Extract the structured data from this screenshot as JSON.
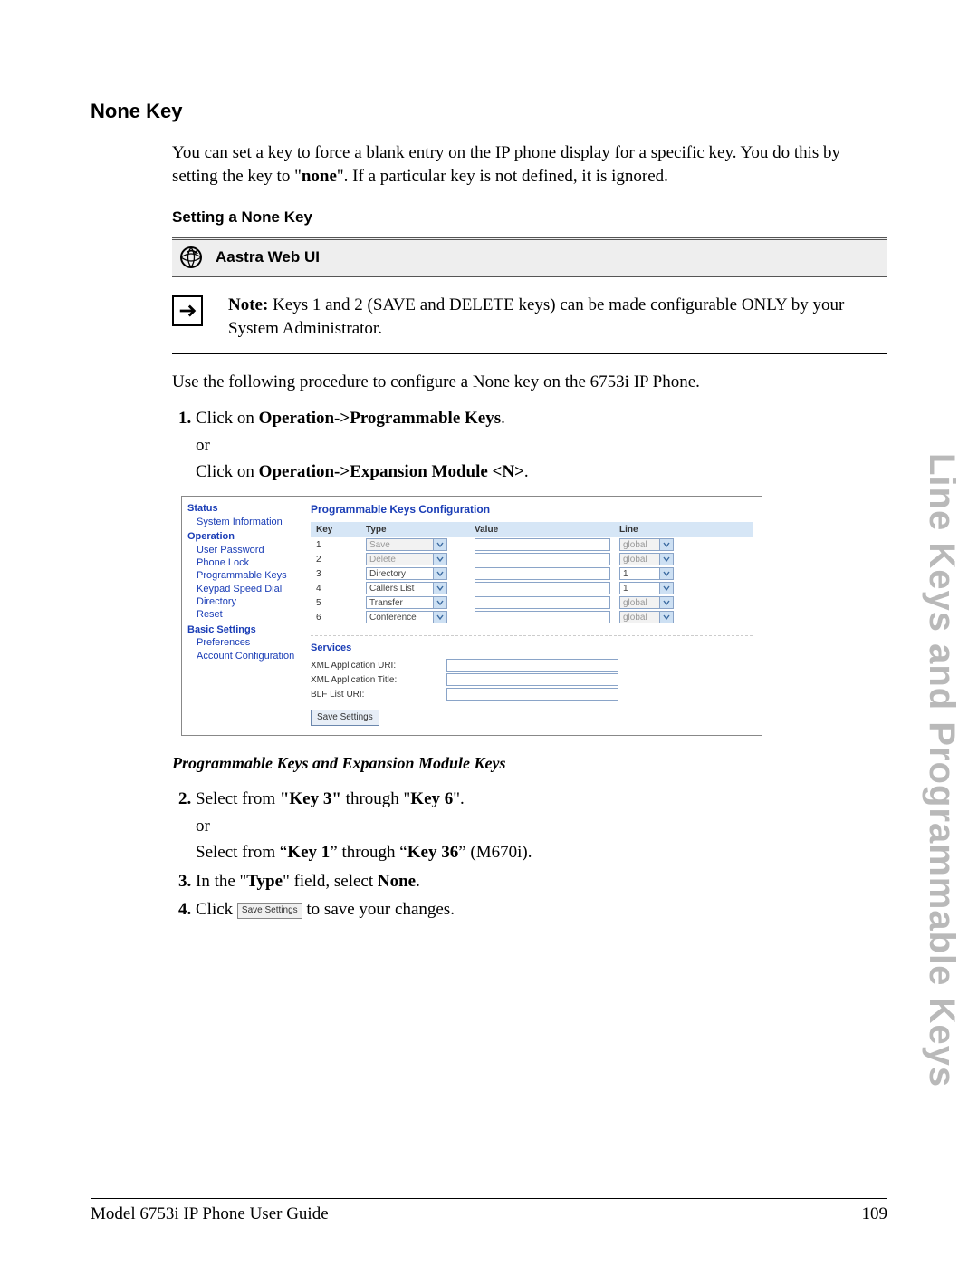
{
  "side_title": "Line Keys and Programmable Keys",
  "heading": "None Key",
  "intro_pre": "You can set a key to force a blank entry on the IP phone display for a specific key. You do this by setting the key to \"",
  "intro_bold": "none",
  "intro_post": "\". If a particular key is not defined, it is ignored.",
  "subheading": "Setting a None Key",
  "ui_bar": "Aastra Web UI",
  "note_bold": "Note:",
  "note_text": " Keys 1 and 2 (SAVE and DELETE keys) can be made configurable ONLY by your System Administrator.",
  "pre_steps": "Use the following procedure to configure a None key on the 6753i IP Phone.",
  "step1": {
    "pre": "Click on ",
    "b1": "Operation->Programmable Keys",
    "post1": ".",
    "or": "or",
    "pre2": "Click on ",
    "b2": "Operation->Expansion Module <N>",
    "post2": "."
  },
  "config": {
    "side": {
      "status": "Status",
      "sysinfo": "System Information",
      "operation": "Operation",
      "items_op": [
        "User Password",
        "Phone Lock",
        "Programmable Keys",
        "Keypad Speed Dial",
        "Directory",
        "Reset"
      ],
      "basic": "Basic Settings",
      "items_basic": [
        "Preferences",
        "Account Configuration"
      ]
    },
    "title": "Programmable Keys Configuration",
    "headers": {
      "key": "Key",
      "type": "Type",
      "value": "Value",
      "line": "Line"
    },
    "rows": [
      {
        "key": "1",
        "type": "Save",
        "type_disabled": true,
        "line": "global",
        "line_disabled": true
      },
      {
        "key": "2",
        "type": "Delete",
        "type_disabled": true,
        "line": "global",
        "line_disabled": true
      },
      {
        "key": "3",
        "type": "Directory",
        "type_disabled": false,
        "line": "1",
        "line_disabled": false
      },
      {
        "key": "4",
        "type": "Callers List",
        "type_disabled": false,
        "line": "1",
        "line_disabled": false
      },
      {
        "key": "5",
        "type": "Transfer",
        "type_disabled": false,
        "line": "global",
        "line_disabled": true
      },
      {
        "key": "6",
        "type": "Conference",
        "type_disabled": false,
        "line": "global",
        "line_disabled": true
      }
    ],
    "services_title": "Services",
    "services": [
      "XML Application URI:",
      "XML Application Title:",
      "BLF List URI:"
    ],
    "save_btn": "Save Settings"
  },
  "caption": "Programmable Keys and Expansion Module Keys",
  "step2": {
    "pre": "Select from ",
    "b1": "\"Key 3\"",
    "mid": " through \"",
    "b2": "Key 6",
    "post": "\".",
    "or": "or",
    "line2_pre": "Select from “",
    "line2_b1": "Key 1",
    "line2_mid": "” through “",
    "line2_b2": "Key 36",
    "line2_post": "” (M670i)."
  },
  "step3": {
    "pre": "In the \"",
    "b1": "Type",
    "mid": "\" field, select ",
    "b2": "None",
    "post": "."
  },
  "step4": {
    "pre": "Click ",
    "btn": "Save Settings",
    "post": " to save your changes."
  },
  "footer_left": "Model 6753i IP Phone User Guide",
  "footer_right": "109"
}
